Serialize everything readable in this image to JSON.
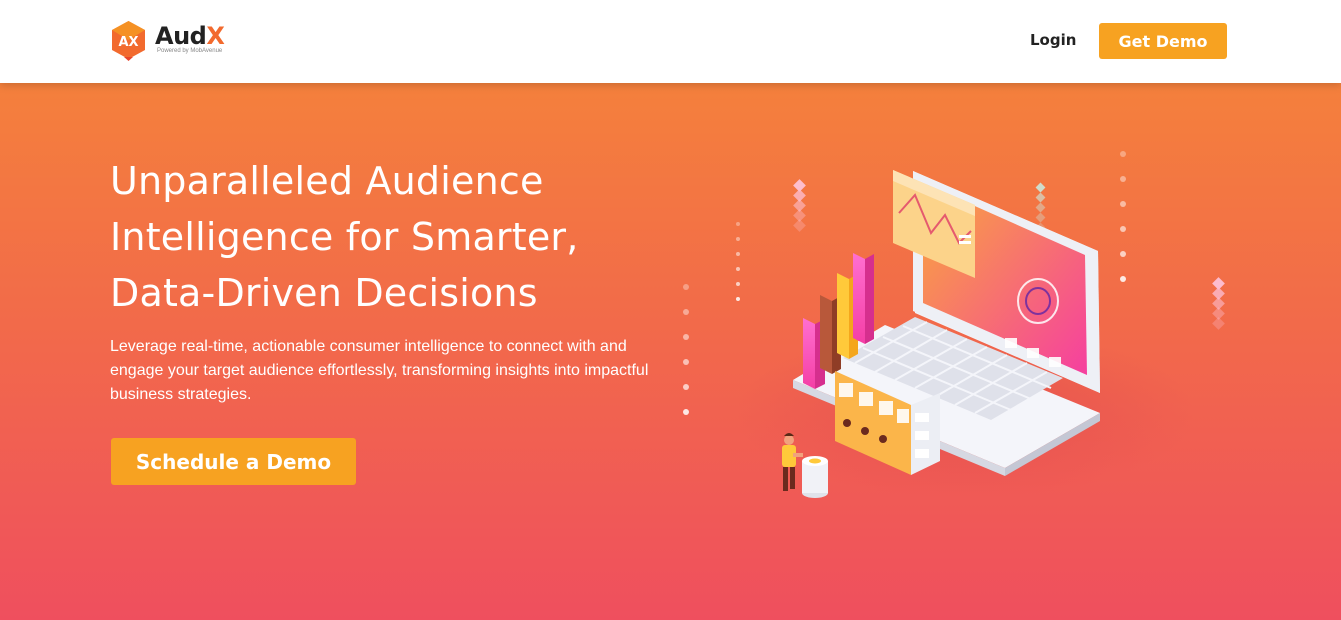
{
  "header": {
    "logo": {
      "mark_text": "AX",
      "brand_main": "Aud",
      "brand_accent": "X",
      "powered_by": "Powered by MobAvenue"
    },
    "nav": {
      "login_label": "Login",
      "get_demo_label": "Get Demo"
    }
  },
  "hero": {
    "headline": "Unparalleled Audience Intelligence for Smarter, Data-Driven Decisions",
    "subtext": "Leverage real-time, actionable consumer intelligence to connect with and engage your target audience effortlessly, transforming insights into impactful business strategies.",
    "cta_label": "Schedule a Demo",
    "illustration": "laptop-analytics-illustration"
  },
  "colors": {
    "accent": "#f7a221",
    "hero_top": "#f4803c",
    "hero_bottom": "#ef4f5e",
    "brand_orange": "#f26a2e"
  }
}
